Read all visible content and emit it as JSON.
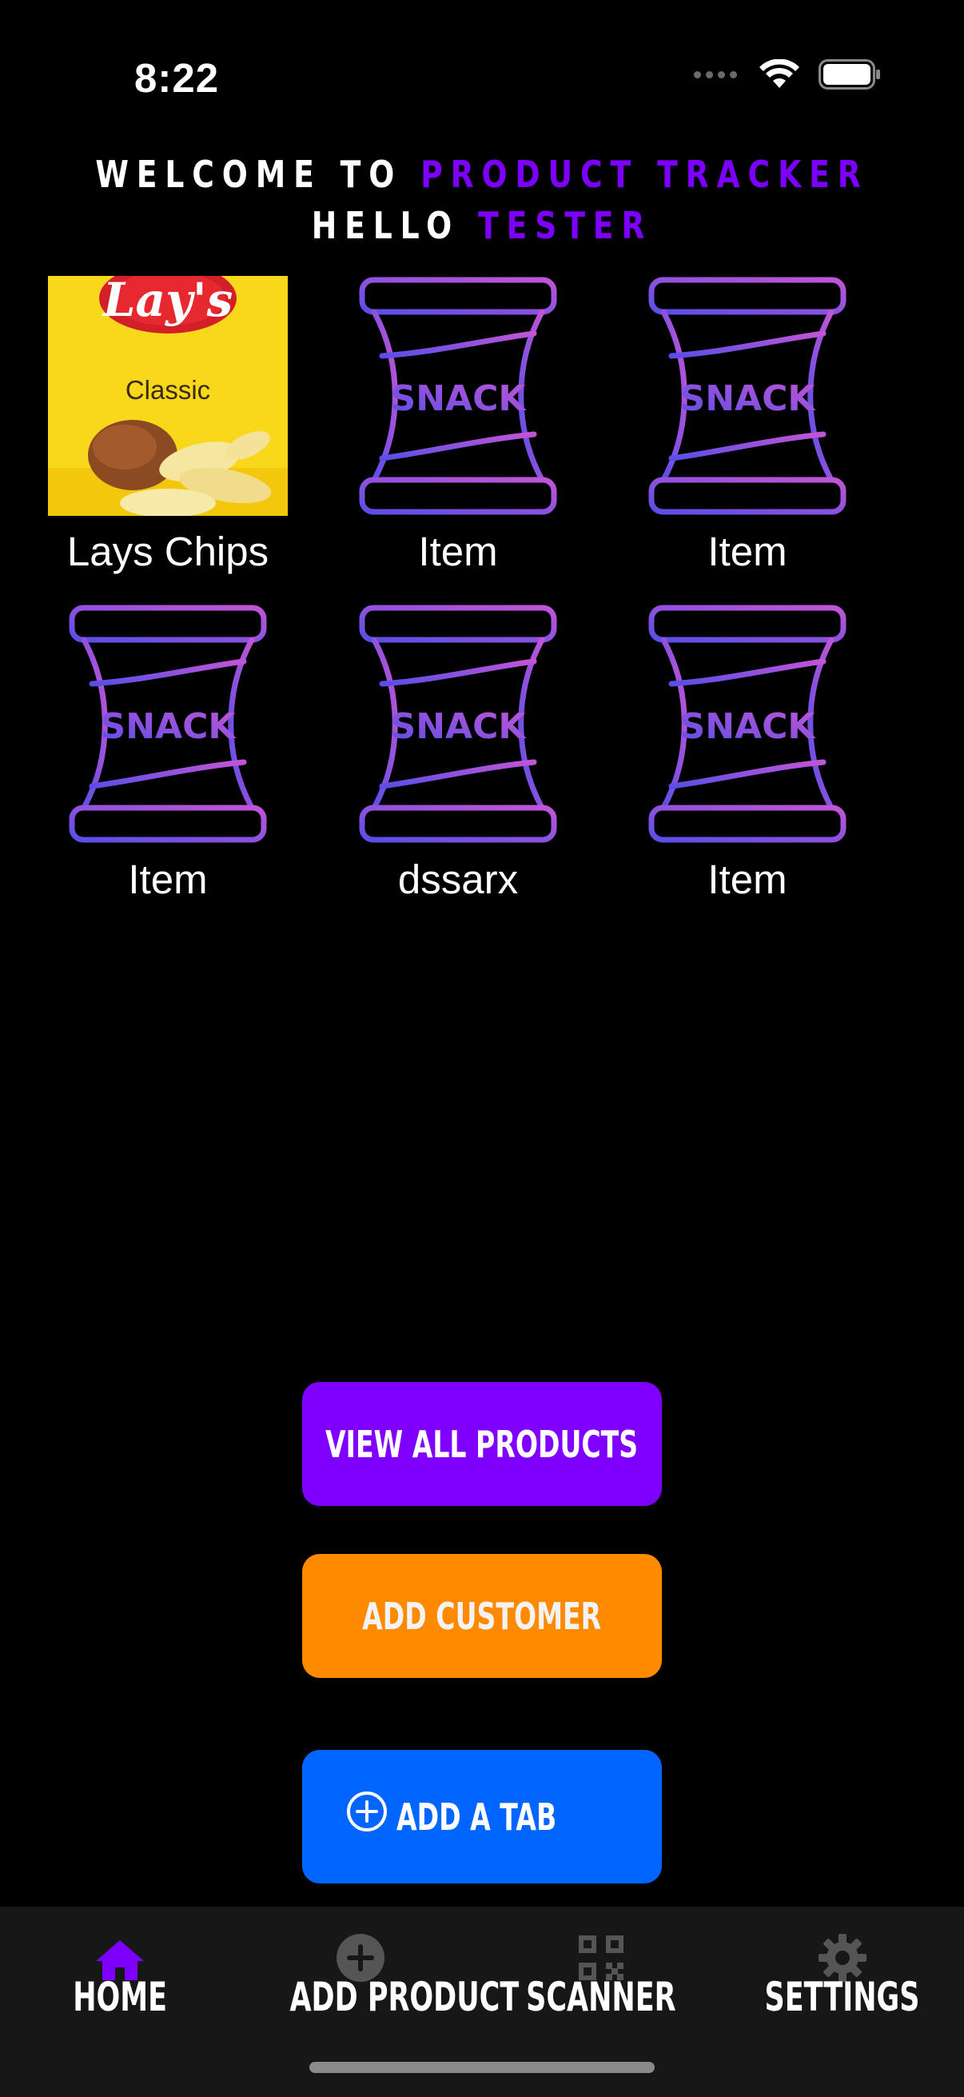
{
  "status_bar": {
    "time": "8:22"
  },
  "header": {
    "line1_prefix": "WELCOME TO",
    "line1_accent": "PRODUCT TRACKER",
    "line2_prefix": "HELLO",
    "line2_accent": "TESTER",
    "accent_color": "#7d00ff"
  },
  "products": [
    {
      "name": "Lays Chips",
      "image": "lays-chips-bag"
    },
    {
      "name": "Item",
      "image": "snack-bag-icon"
    },
    {
      "name": "Item",
      "image": "snack-bag-icon"
    },
    {
      "name": "Item",
      "image": "snack-bag-icon"
    },
    {
      "name": "dssarx",
      "image": "snack-bag-icon"
    },
    {
      "name": "Item",
      "image": "snack-bag-icon"
    }
  ],
  "snack_icon_text": "SNACK",
  "lays_bag": {
    "brand": "Lay's",
    "flavor": "Classic"
  },
  "buttons": {
    "view_all": "VIEW ALL PRODUCTS",
    "add_customer": "ADD CUSTOMER",
    "add_tab": "ADD A TAB"
  },
  "button_colors": {
    "view_all": "#8000ff",
    "add_customer": "#ff8a00",
    "add_tab": "#0066ff"
  },
  "tabbar": {
    "items": [
      {
        "label": "HOME",
        "icon": "house-icon",
        "active": true
      },
      {
        "label": "ADD PRODUCT",
        "icon": "plus-circle-icon",
        "active": false
      },
      {
        "label": "SCANNER",
        "icon": "qrcode-icon",
        "active": false
      },
      {
        "label": "SETTINGS",
        "icon": "gear-icon",
        "active": false
      }
    ],
    "active_color": "#7d00ff",
    "inactive_icon_color": "#555555"
  }
}
